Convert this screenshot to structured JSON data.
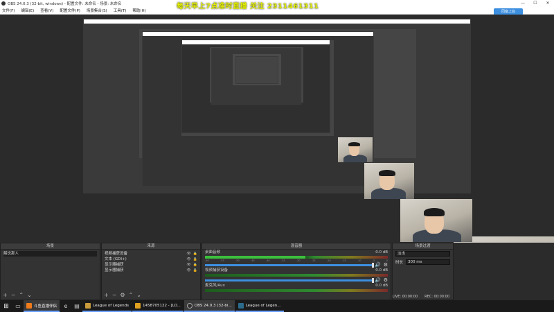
{
  "window": {
    "title": "OBS 24.0.3 (32-bit, windows) - 配置文件: 未命名 - 场景: 未命名",
    "minimize": "—",
    "maximize": "☐",
    "close": "✕"
  },
  "menu": [
    "文件(F)",
    "编辑(E)",
    "查看(V)",
    "配置文件(P)",
    "场景集合(S)",
    "工具(T)",
    "帮助(H)"
  ],
  "overlay_text": "每天早上7点准时直播  关注 2311461311",
  "share_button": "同窗上台",
  "scenes": {
    "title": "场景",
    "items": [
      "解说那人"
    ]
  },
  "sources": {
    "title": "来源",
    "items": [
      "视频捕获设备",
      "文本 (GDI+)",
      "显示器捕获",
      "显示器捕获"
    ]
  },
  "mixer": {
    "title": "混音器",
    "tracks": [
      {
        "name": "桌面音频",
        "level": "0.0 dB"
      },
      {
        "name": "视频捕获设备",
        "level": "0.0 dB"
      },
      {
        "name": "麦克风/Aux",
        "level": "0.0 dB"
      }
    ],
    "ticks": [
      "-60",
      "-55",
      "-50",
      "-45",
      "-40",
      "-35",
      "-30",
      "-25",
      "-20",
      "-15",
      "-10",
      "-5",
      "0"
    ]
  },
  "transitions": {
    "title": "场景过渡",
    "type": "淡出",
    "duration_label": "时长",
    "duration_value": "300 ms"
  },
  "status": {
    "live": "LIVE: 00:00:00",
    "rec": "REC: 00:00:00"
  },
  "taskbar": {
    "apps": [
      {
        "label": "斗鱼直播伴侣",
        "color": "#f07b1b"
      },
      {
        "label": "League of Legends",
        "color": "#c89b3c"
      },
      {
        "label": "1458705122 - [LO...",
        "color": "#e0a020"
      },
      {
        "label": "OBS 24.0.3 (32-bi...",
        "color": "#303030"
      },
      {
        "label": "League of Legen...",
        "color": "#2a6b8c"
      }
    ]
  },
  "colors": {
    "accent": "#3d8fe0",
    "overlay": "#e6f200",
    "panel": "#333333"
  }
}
